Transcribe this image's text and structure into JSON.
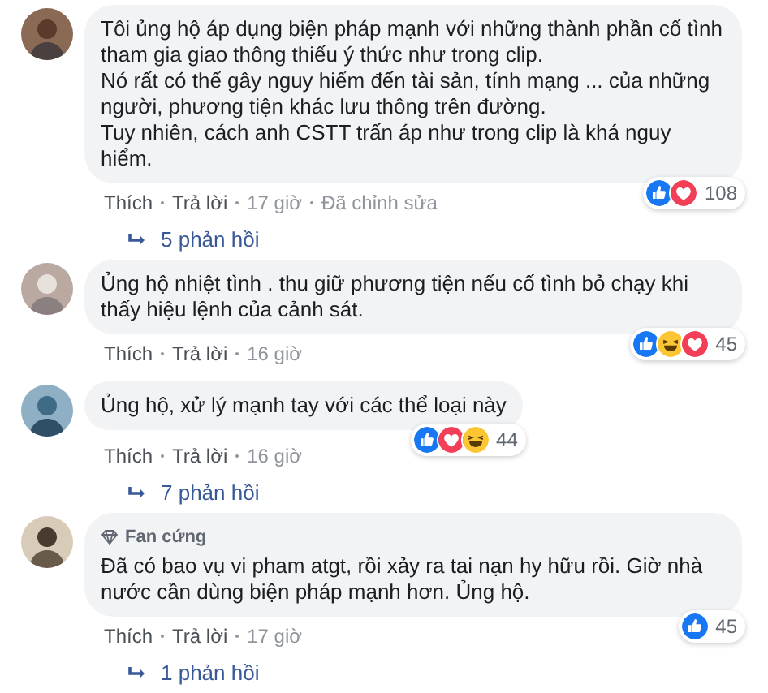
{
  "comments": [
    {
      "text": "Tôi ủng hộ áp dụng biện pháp mạnh với những thành phần cố tình tham gia giao thông thiếu ý thức như trong clip.\nNó rất có thể gây nguy hiểm đến tài sản, tính mạng ... của những người, phương tiện khác lưu thông trên đường.\nTuy nhiên, cách anh CSTT trấn áp như trong clip là khá nguy hiểm.",
      "reactions": [
        {
          "kind": "like"
        },
        {
          "kind": "love"
        }
      ],
      "reaction_count": "108",
      "actions": [
        "Thích",
        "Trả lời",
        "17 giờ",
        "Đã chỉnh sửa"
      ],
      "replies": "5 phản hồi"
    },
    {
      "text": "Ủng hộ nhiệt tình . thu giữ phương tiện nếu cố tình bỏ chạy khi thấy hiệu lệnh của cảnh sát.",
      "reactions": [
        {
          "kind": "like"
        },
        {
          "kind": "haha"
        },
        {
          "kind": "love"
        }
      ],
      "reaction_count": "45",
      "actions": [
        "Thích",
        "Trả lời",
        "16 giờ"
      ]
    },
    {
      "text": "Ủng hộ, xử lý mạnh tay với các thể loại này",
      "reactions": [
        {
          "kind": "like"
        },
        {
          "kind": "love"
        },
        {
          "kind": "haha"
        }
      ],
      "reaction_count": "44",
      "actions": [
        "Thích",
        "Trả lời",
        "16 giờ"
      ],
      "replies": "7 phản hồi"
    },
    {
      "badge": "Fan cứng",
      "text": "Đã có bao vụ vi pham atgt, rồi xảy ra tai nạn hy hữu rồi. Giờ nhà nước cần dùng biện pháp mạnh hơn. Ủng hộ.",
      "reactions": [
        {
          "kind": "like"
        }
      ],
      "reaction_count": "45",
      "actions": [
        "Thích",
        "Trả lời",
        "17 giờ"
      ],
      "replies": "1 phản hồi"
    }
  ]
}
